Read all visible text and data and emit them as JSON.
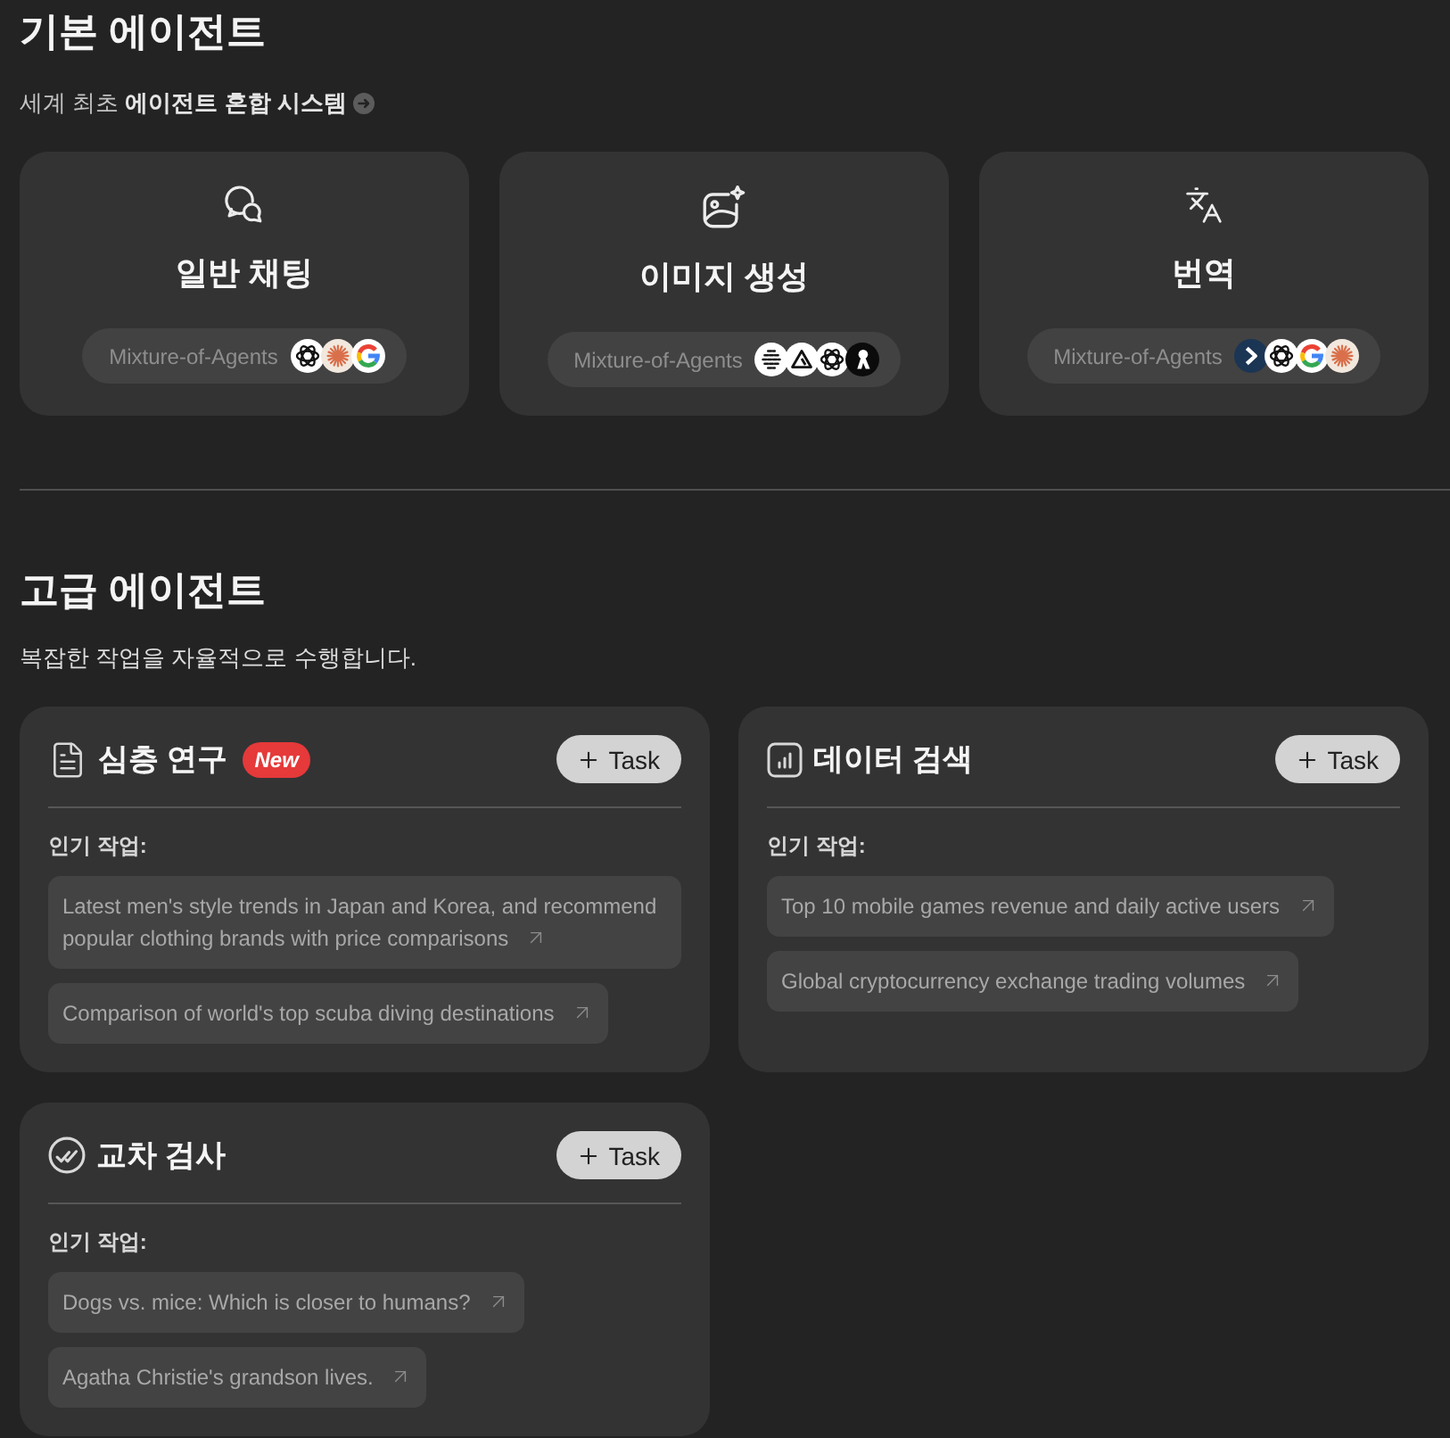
{
  "basic_agents": {
    "title": "기본 에이전트",
    "subtitle": "세계 최초 **에이전트 혼합 시스템**",
    "agents": [
      {
        "kind": "chat",
        "name": "일반 채팅",
        "pill": "Mixture-of-Agents",
        "models": [
          {
            "kind": "atom"
          },
          {
            "kind": "starburst"
          },
          {
            "kind": "g"
          }
        ]
      },
      {
        "kind": "image",
        "name": "이미지 생성",
        "pill": "Mixture-of-Agents",
        "models": [
          {
            "kind": "striped"
          },
          {
            "kind": "triangle"
          },
          {
            "kind": "atom"
          },
          {
            "kind": "figure"
          }
        ]
      },
      {
        "kind": "translate",
        "name": "번역",
        "pill": "Mixture-of-Agents",
        "models": [
          {
            "kind": "chevron"
          },
          {
            "kind": "atom"
          },
          {
            "kind": "g"
          },
          {
            "kind": "starburst"
          }
        ]
      }
    ]
  },
  "advanced_agents": {
    "title": "고급 에이전트",
    "subtitle": "복잡한 작업을 자율적으로 수행합니다.",
    "agents": [
      {
        "kind": "document",
        "name": "심층 연구",
        "badge": "New",
        "button": "Task",
        "popular_label": "인기 작업:",
        "tasks": [
          "Latest men's style trends in Japan and Korea, and recommend popular clothing brands with price comparisons",
          "Comparison of world's top scuba diving destinations"
        ]
      },
      {
        "kind": "chart",
        "name": "데이터 검색",
        "button": "Task",
        "popular_label": "인기 작업:",
        "tasks": [
          "Top 10 mobile games revenue and daily active users",
          "Global cryptocurrency exchange trading volumes"
        ]
      },
      {
        "kind": "check",
        "name": "교차 검사",
        "button": "Task",
        "popular_label": "인기 작업:",
        "tasks": [
          "Dogs vs. mice: Which is closer to humans?",
          "Agatha Christie's grandson lives."
        ]
      }
    ]
  }
}
